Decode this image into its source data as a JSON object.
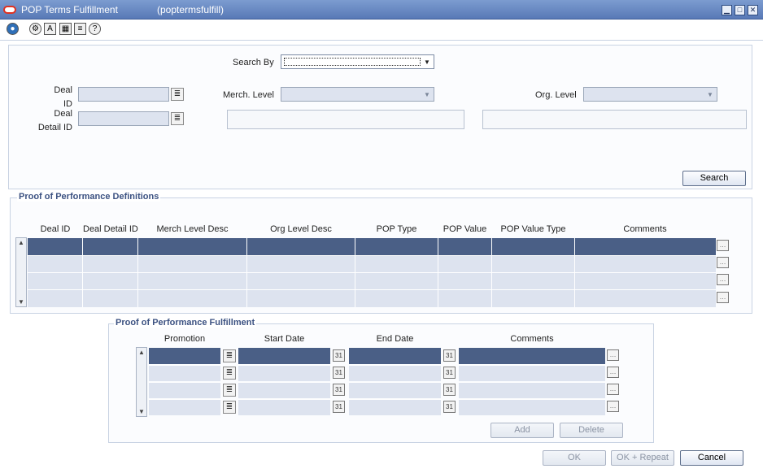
{
  "window": {
    "title": "POP Terms Fulfillment",
    "form_id": "(poptermsfulfill)"
  },
  "icons": {
    "logo": "oracle-logo-icon",
    "minimize": "minimize-icon",
    "maximize": "maximize-icon",
    "close": "close-icon",
    "toolbar": [
      "globe-icon",
      "options-icon",
      "spellcheck-icon",
      "calendar-icon",
      "notes-icon",
      "help-icon"
    ],
    "lov": "list-of-values-icon",
    "comment": "comment-icon",
    "calendar": "calendar-icon"
  },
  "search": {
    "search_by_label": "Search By",
    "search_by_value": "",
    "deal_id_label": "Deal\nID",
    "deal_id_value": "",
    "deal_detail_label": "Deal\nDetail ID",
    "deal_detail_value": "",
    "merch_level_label": "Merch. Level",
    "merch_level_value": "",
    "org_level_label": "Org. Level",
    "org_level_value": "",
    "search_button": "Search"
  },
  "definitions": {
    "title": "Proof of Performance Definitions",
    "columns": [
      "Deal ID",
      "Deal Detail ID",
      "Merch Level Desc",
      "Org Level Desc",
      "POP Type",
      "POP Value",
      "POP Value Type",
      "Comments"
    ],
    "rows": [
      [
        "",
        "",
        "",
        "",
        "",
        "",
        "",
        ""
      ],
      [
        "",
        "",
        "",
        "",
        "",
        "",
        "",
        ""
      ],
      [
        "",
        "",
        "",
        "",
        "",
        "",
        "",
        ""
      ],
      [
        "",
        "",
        "",
        "",
        "",
        "",
        "",
        ""
      ]
    ]
  },
  "fulfillment": {
    "title": "Proof of Performance Fulfillment",
    "columns": [
      "Promotion",
      "Start Date",
      "End Date",
      "Comments"
    ],
    "rows": [
      [
        "",
        "",
        "",
        ""
      ],
      [
        "",
        "",
        "",
        ""
      ],
      [
        "",
        "",
        "",
        ""
      ],
      [
        "",
        "",
        "",
        ""
      ]
    ],
    "add_button": "Add",
    "delete_button": "Delete"
  },
  "footer": {
    "ok_button": "OK",
    "ok_repeat_button": "OK + Repeat",
    "cancel_button": "Cancel"
  },
  "colors": {
    "titlebar": "#5879b6",
    "selected_row": "#4a5f86",
    "row": "#dde3ef",
    "section_title": "#3c5282"
  }
}
